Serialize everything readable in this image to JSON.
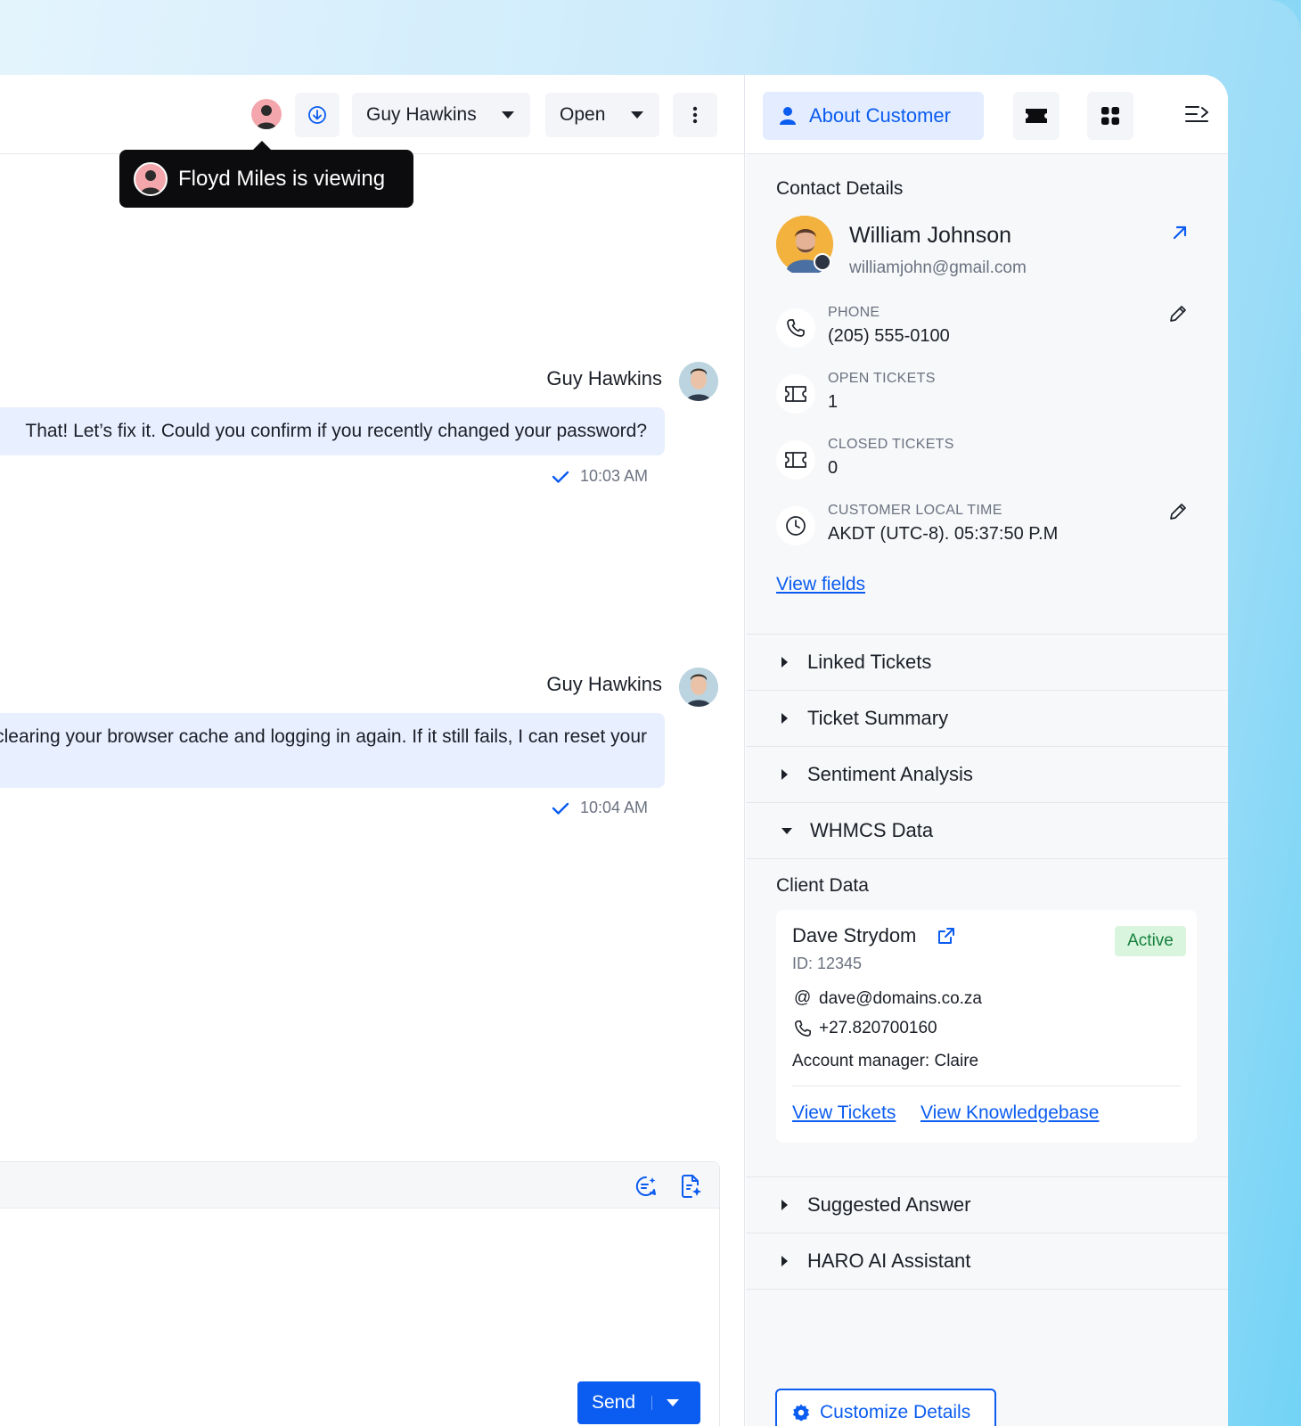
{
  "viewer_tooltip": "Floyd Miles is viewing",
  "header": {
    "assignee": "Guy Hawkins",
    "status": "Open"
  },
  "messages": [
    {
      "sender": "Guy Hawkins",
      "text": "That! Let’s fix it. Could you confirm if you recently changed your password?",
      "time": "10:03 AM"
    },
    {
      "sender": "Guy Hawkins",
      "text": "Try clearing your browser cache and logging in again. If it still fails, I can reset your",
      "time": "10:04 AM"
    }
  ],
  "composer": {
    "send_label": "Send"
  },
  "panel": {
    "tab_label": "About Customer",
    "contact_title": "Contact Details",
    "name": "William Johnson",
    "email": "williamjohn@gmail.com",
    "fields": [
      {
        "label": "PHONE",
        "value": "(205) 555-0100",
        "icon": "phone-icon"
      },
      {
        "label": "OPEN TICKETS",
        "value": "1",
        "icon": "ticket-icon"
      },
      {
        "label": "CLOSED TICKETS",
        "value": "0",
        "icon": "ticket-icon"
      },
      {
        "label": "CUSTOMER LOCAL TIME",
        "value": "AKDT (UTC-8). 05:37:50 P.M",
        "icon": "clock-icon"
      }
    ],
    "view_fields": "View fields",
    "sections": [
      "Linked Tickets",
      "Ticket Summary",
      "Sentiment Analysis",
      "WHMCS Data"
    ],
    "client_title": "Client Data",
    "client": {
      "name": "Dave Strydom",
      "id": "ID: 12345",
      "status": "Active",
      "email": "dave@domains.co.za",
      "phone": "+27.820700160",
      "manager": "Account manager: Claire",
      "view_tickets": "View Tickets",
      "view_kb": "View Knowledgebase"
    },
    "bottom_sections": [
      "Suggested Answer",
      "HARO AI Assistant"
    ],
    "customize_label": "Customize Details"
  },
  "colors": {
    "accent": "#0b5cf0",
    "active_bg": "#d9f5dd",
    "active_text": "#15803d"
  }
}
